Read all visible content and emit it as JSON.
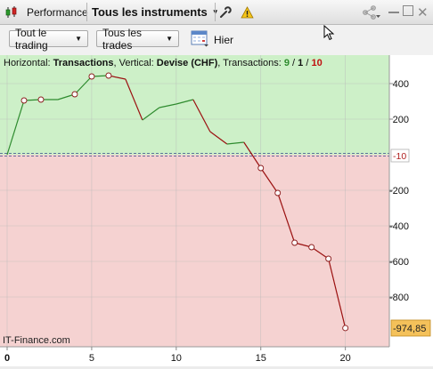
{
  "toolbar_top": {
    "performance_label": "Performance",
    "instruments_label": "Tous les instruments"
  },
  "filters": {
    "trading_label": "Tout le trading",
    "trades_label": "Tous les trades",
    "period_label": "Hier"
  },
  "info": {
    "horizontal_prefix": "Horizontal: ",
    "horizontal_value": "Transactions",
    "vertical_prefix": ", Vertical: ",
    "vertical_value": "Devise (CHF)",
    "transactions_prefix": ", Transactions: ",
    "wins": "9",
    "slash1": " / ",
    "neutral": "1",
    "slash2": " / ",
    "losses": "10"
  },
  "brand": "IT-Finance.com",
  "colors": {
    "profit_zone": "#cdf0c8",
    "loss_zone": "#f5d2d1",
    "profit_line": "#2e8b2e",
    "loss_line": "#9b1111",
    "last_value_badge": "#f4c15a"
  },
  "chart_data": {
    "type": "line",
    "x": [
      0,
      1,
      2,
      3,
      4,
      5,
      6,
      7,
      8,
      9,
      10,
      11,
      12,
      13,
      14,
      15,
      16,
      17,
      18,
      19,
      20
    ],
    "y": [
      0,
      305,
      310,
      310,
      340,
      440,
      445,
      425,
      195,
      265,
      285,
      310,
      130,
      60,
      70,
      -75,
      -215,
      -495,
      -520,
      -585,
      -974.85
    ],
    "markers_at": [
      1,
      2,
      4,
      5,
      6,
      15,
      16,
      17,
      18,
      19,
      20
    ],
    "xlim": [
      0,
      22
    ],
    "ylim": [
      -1080,
      560
    ],
    "x_ticks": [
      "0",
      "5",
      "10",
      "15",
      "20"
    ],
    "y_ticks": [
      "400",
      "200",
      "-200",
      "-400",
      "-600",
      "-800"
    ],
    "zero_label": "-10",
    "last_value_label": "-974,85",
    "grid": true
  }
}
